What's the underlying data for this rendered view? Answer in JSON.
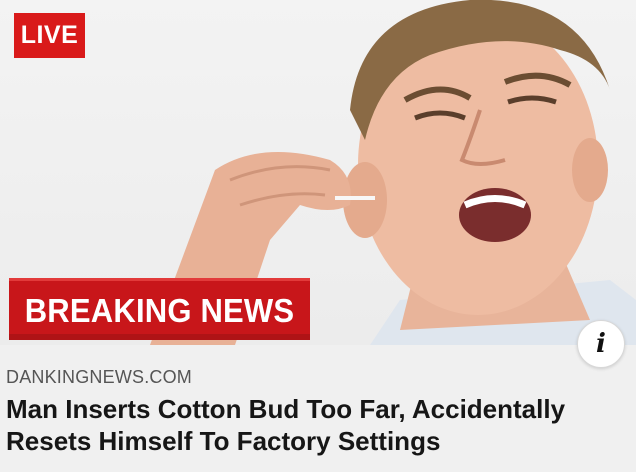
{
  "badges": {
    "live": "LIVE",
    "breaking": "BREAKING NEWS"
  },
  "info_button": {
    "glyph": "i",
    "icon": "info-icon"
  },
  "article": {
    "source": "DANKINGNEWS.COM",
    "headline": "Man Inserts Cotton Bud Too Far, Accidentally Resets Himself To Factory Settings"
  },
  "colors": {
    "live_red": "#d91a1a",
    "breaking_red": "#c8161a",
    "caption_bg": "#f0f0f0"
  }
}
